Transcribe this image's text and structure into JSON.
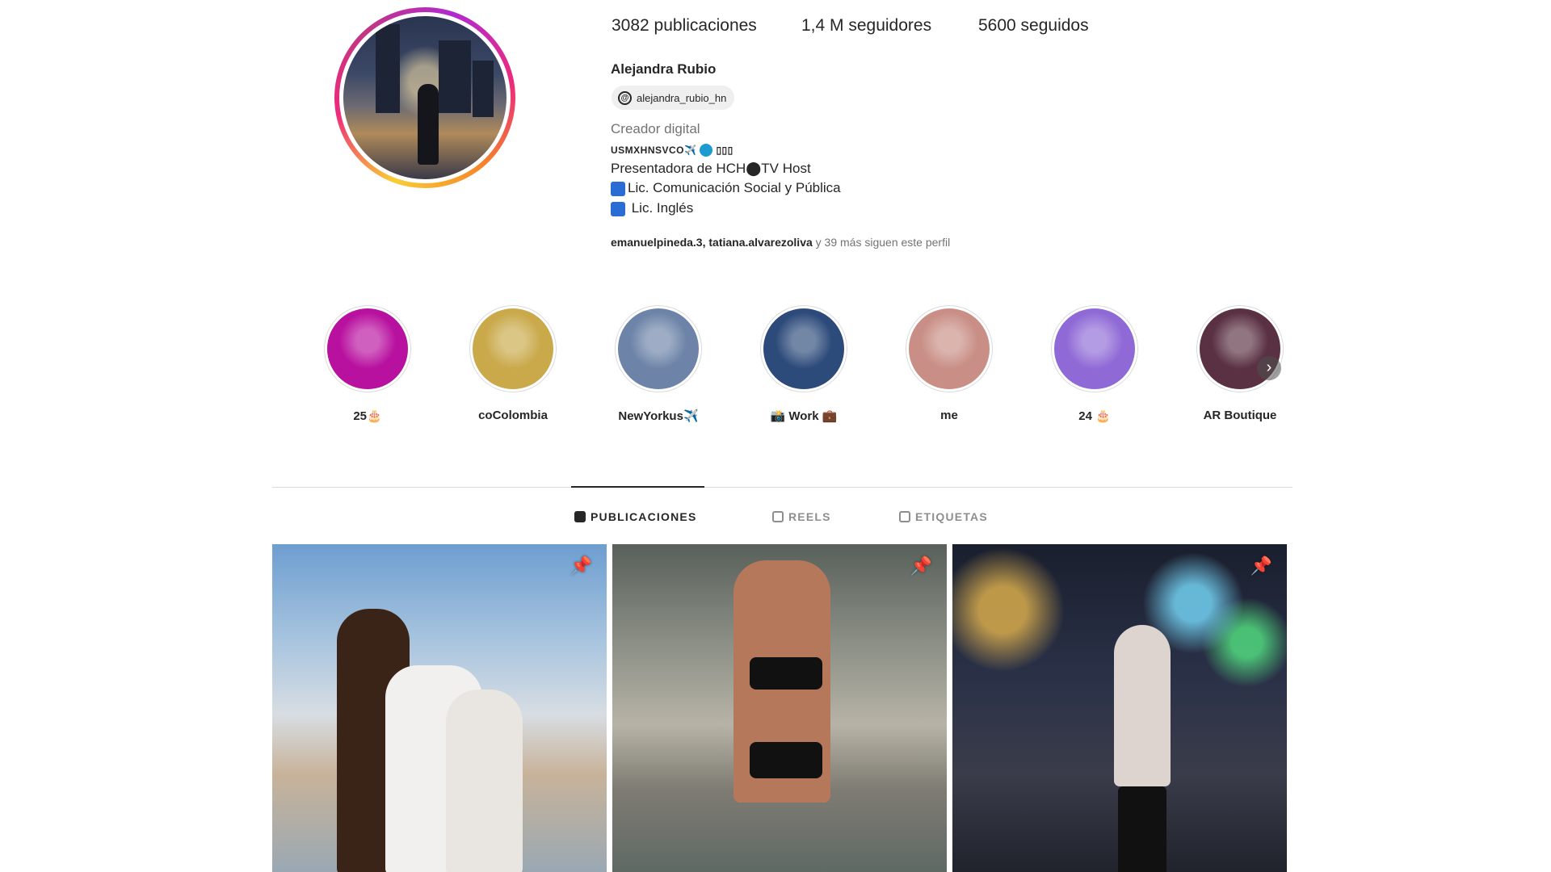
{
  "profile": {
    "stats": {
      "posts": "3082 publicaciones",
      "followers": "1,4 M seguidores",
      "following": "5600 seguidos"
    },
    "name": "Alejandra Rubio",
    "threads_handle": "alejandra_rubio_hn",
    "category": "Creador digital",
    "bio_line1": "USMXHNSVCO✈️",
    "bio_line1_suffix": "▯▯▯",
    "bio_line2": "Presentadora de HCH⬤TV Host",
    "bio_line3": "Lic. Comunicación Social y Pública",
    "bio_line4": " Lic. Inglés",
    "followed_by_names": "emanuelpineda.3, tatiana.alvarezoliva",
    "followed_by_suffix": " y 39 más siguen este perfil"
  },
  "highlights": [
    {
      "label": "25🎂",
      "color": "#b8109f"
    },
    {
      "label": "coColombia",
      "color": "#c9a94a"
    },
    {
      "label": "NewYorkus✈️",
      "color": "#6d84a8"
    },
    {
      "label": "📸 Work 💼",
      "color": "#2c4a7a"
    },
    {
      "label": "me",
      "color": "#c98f86"
    },
    {
      "label": "24 🎂",
      "color": "#8f6ad6"
    },
    {
      "label": "AR Boutique",
      "color": "#5a3142"
    }
  ],
  "tabs": {
    "posts": "PUBLICACIONES",
    "reels": "REELS",
    "tagged": "ETIQUETAS"
  },
  "icons": {
    "pin": "pin-icon",
    "threads": "threads-icon",
    "next": "chevron-right-icon"
  }
}
